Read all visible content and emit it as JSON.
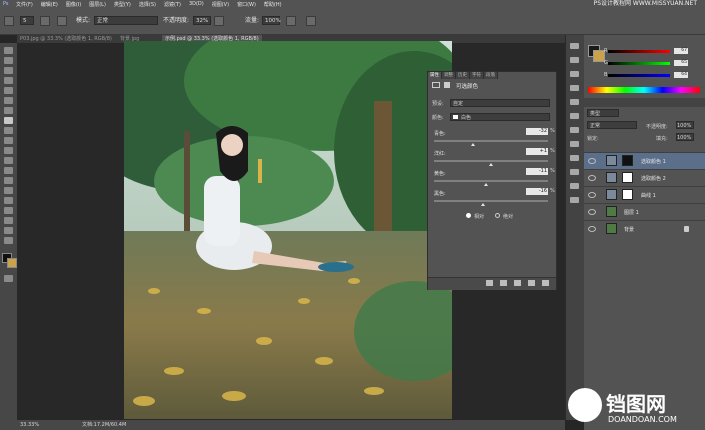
{
  "menu": [
    "文件(F)",
    "编辑(E)",
    "图像(I)",
    "图层(L)",
    "类型(Y)",
    "选择(S)",
    "滤镜(T)",
    "3D(D)",
    "视图(V)",
    "窗口(W)",
    "帮助(H)"
  ],
  "brand": "PS设计教程网 WWW.MISSYUAN.NET",
  "options": {
    "size_value": "5",
    "mode_label": "模式:",
    "mode_value": "正常",
    "opacity_label": "不透明度:",
    "opacity_value": "32%",
    "flow_label": "流量:",
    "flow_value": "100%"
  },
  "tabs": [
    "P03.jpg @ 33.3% (选取颜色 1, RGB/8)",
    "背景.jpg",
    "示例.psd @ 33.3% (选取颜色 1, RGB/8)"
  ],
  "adjust_panel": {
    "tabs": [
      "属性",
      "调整",
      "历史",
      "字符",
      "段落"
    ],
    "title": "可选颜色",
    "preset_label": "预设:",
    "preset_value": "自定",
    "color_label": "颜色:",
    "color_value": "白色",
    "sliders": [
      {
        "label": "青色:",
        "value": "-32",
        "pct": "%"
      },
      {
        "label": "洋红:",
        "value": "+1",
        "pct": "%"
      },
      {
        "label": "黄色:",
        "value": "-11",
        "pct": "%"
      },
      {
        "label": "黑色:",
        "value": "-16",
        "pct": "%"
      }
    ],
    "radio_relative": "相对",
    "radio_absolute": "绝对"
  },
  "color_panel": {
    "channels": [
      "R",
      "G",
      "B"
    ],
    "values": [
      "67",
      "65",
      "64"
    ]
  },
  "layers": {
    "blend_value": "正常",
    "opacity_label": "不透明度:",
    "opacity_value": "100%",
    "lock_label": "锁定:",
    "fill_label": "填充:",
    "fill_value": "100%",
    "kind_label": "类型",
    "items": [
      {
        "name": "选取颜色 1",
        "selected": true,
        "mask": "dark"
      },
      {
        "name": "选取颜色 2",
        "selected": false,
        "mask": "white"
      },
      {
        "name": "曲线 1",
        "selected": false,
        "mask": "white"
      },
      {
        "name": "图层 1",
        "selected": false,
        "mask": "photo"
      },
      {
        "name": "背景",
        "selected": false,
        "mask": "photo"
      }
    ]
  },
  "status": {
    "zoom": "33.33%",
    "doc": "文档:17.2M/60.4M"
  },
  "watermark": {
    "name": "铛图网",
    "url": "DOANDOAN.COM"
  }
}
